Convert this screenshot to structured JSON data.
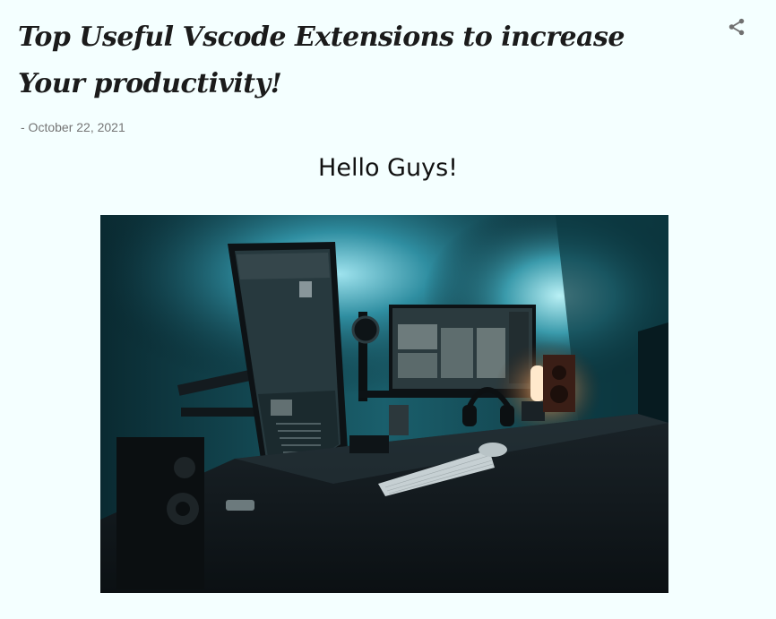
{
  "post": {
    "title": "Top Useful Vscode Extensions to increase Your productivity!",
    "date": "- October 22, 2021",
    "greeting": "Hello Guys!"
  },
  "icons": {
    "share": "share-icon"
  },
  "image": {
    "subject": "desk-setup-photo"
  },
  "colors": {
    "background": "#f4ffff",
    "title": "#1b1b1b",
    "date": "#757575",
    "share_icon": "#707070"
  }
}
